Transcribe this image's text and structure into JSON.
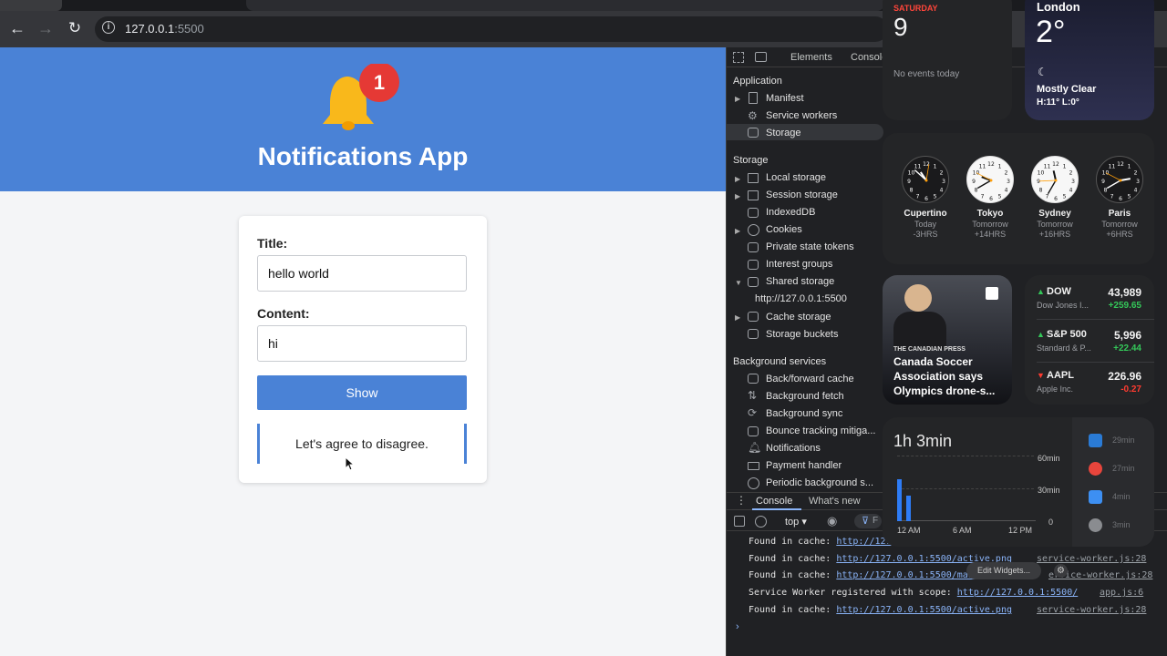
{
  "browser": {
    "url_host": "127.0.0.1",
    "url_port": ":5500"
  },
  "page": {
    "app_title": "Notifications App",
    "badge_count": "1",
    "form": {
      "title_label": "Title:",
      "title_value": "hello world",
      "content_label": "Content:",
      "content_value": "hi",
      "show_button": "Show",
      "quote": "Let's agree to disagree."
    }
  },
  "devtools": {
    "tabs": [
      "Elements",
      "Console"
    ],
    "application_header": "Application",
    "application_items": [
      "Manifest",
      "Service workers",
      "Storage"
    ],
    "storage_header": "Storage",
    "storage_items": [
      "Local storage",
      "Session storage",
      "IndexedDB",
      "Cookies",
      "Private state tokens",
      "Interest groups",
      "Shared storage",
      "http://127.0.0.1:5500",
      "Cache storage",
      "Storage buckets"
    ],
    "background_header": "Background services",
    "background_items": [
      "Back/forward cache",
      "Background fetch",
      "Background sync",
      "Bounce tracking mitiga...",
      "Notifications",
      "Payment handler",
      "Periodic background s..."
    ],
    "drawer_tabs": [
      "Console",
      "What's new"
    ],
    "context": "top",
    "filter_placeholder": "F",
    "logs": [
      {
        "prefix": "Found in cache: ",
        "link": "http://127",
        "source": ""
      },
      {
        "prefix": "Found in cache: ",
        "link": "http://127.0.0.1:5500/active.png",
        "source": "service-worker.js:28"
      },
      {
        "prefix": "Found in cache: ",
        "link": "http://127.0.0.1:5500/mani",
        "source": "ervice-worker.js:28"
      },
      {
        "prefix": "Service Worker registered with scope: ",
        "link": "http://127.0.0.1:5500/",
        "source": "app.js:6"
      },
      {
        "prefix": "Found in cache: ",
        "link": "http://127.0.0.1:5500/active.png",
        "source": "service-worker.js:28"
      }
    ],
    "edit_widgets": "Edit Widgets..."
  },
  "widgets": {
    "calendar": {
      "day": "SATURDAY",
      "date": "9",
      "events": "No events today"
    },
    "weather": {
      "city": "London",
      "temp": "2°",
      "condition": "Mostly Clear",
      "range": "H:11° L:0°"
    },
    "clocks": [
      {
        "city": "Cupertino",
        "day": "Today",
        "offset": "-3HRS",
        "dark": true
      },
      {
        "city": "Tokyo",
        "day": "Tomorrow",
        "offset": "+14HRS",
        "dark": false
      },
      {
        "city": "Sydney",
        "day": "Tomorrow",
        "offset": "+16HRS",
        "dark": false
      },
      {
        "city": "Paris",
        "day": "Tomorrow",
        "offset": "+6HRS",
        "dark": true
      }
    ],
    "news": {
      "source": "THE CANADIAN PRESS",
      "headline": "Canada Soccer Association says Olympics drone-s..."
    },
    "stocks": [
      {
        "symbol": "DOW",
        "name": "Dow Jones I...",
        "price": "43,989",
        "change": "+259.65",
        "up": true
      },
      {
        "symbol": "S&P 500",
        "name": "Standard & P...",
        "price": "5,996",
        "change": "+22.44",
        "up": true
      },
      {
        "symbol": "AAPL",
        "name": "Apple Inc.",
        "price": "226.96",
        "change": "-0.27",
        "up": false
      }
    ],
    "screentime": {
      "total": "1h 3min",
      "y_labels": [
        "60min",
        "30min",
        "0"
      ],
      "x_labels": [
        "12 AM",
        "6 AM",
        "12 PM"
      ],
      "apps": [
        {
          "name": "vscode-icon",
          "time": "29min",
          "color": "#2a7bd6"
        },
        {
          "name": "chrome-icon",
          "time": "27min",
          "color": "#e8453c"
        },
        {
          "name": "safari-icon",
          "time": "4min",
          "color": "#3d8ff2"
        },
        {
          "name": "finder-icon",
          "time": "3min",
          "color": "#8a8c90"
        }
      ]
    },
    "colors": {
      "accent_blue": "#4a82d6",
      "up": "#34c759",
      "down": "#ff3b30"
    }
  }
}
